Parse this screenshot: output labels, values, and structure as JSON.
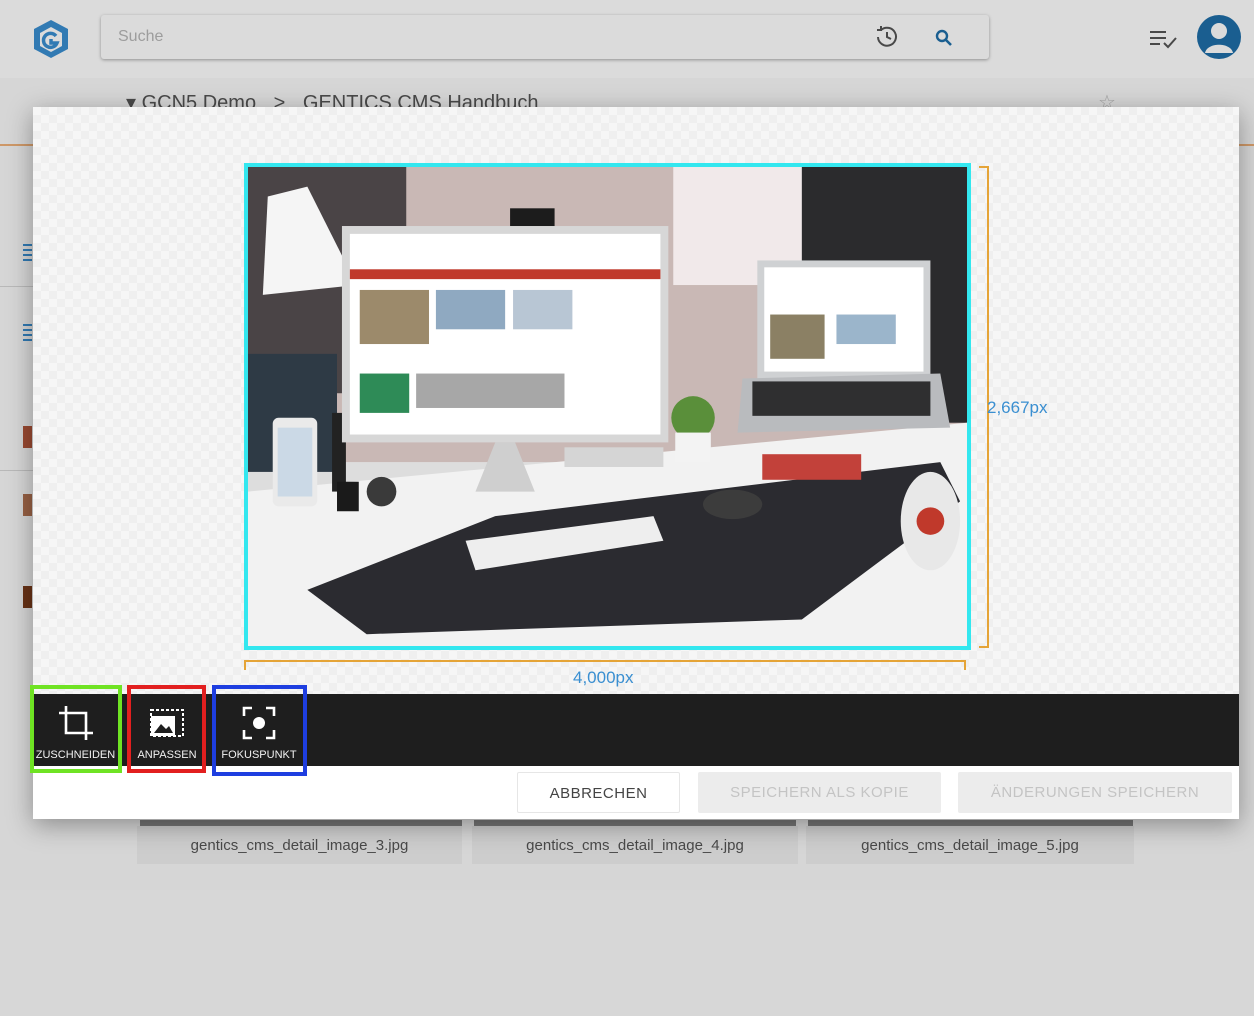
{
  "header": {
    "search_placeholder": "Suche",
    "icons": [
      "history-icon",
      "search-icon",
      "tasks-icon",
      "user-avatar-icon"
    ]
  },
  "breadcrumb": {
    "items": [
      "GCN5 Demo",
      "GENTICS CMS Handbuch"
    ],
    "separator": ">"
  },
  "thumbnails": [
    "gentics_cms_detail_image_3.jpg",
    "gentics_cms_detail_image_4.jpg",
    "gentics_cms_detail_image_5.jpg"
  ],
  "editor": {
    "width_label": "4,000px",
    "height_label": "2,667px",
    "crop_frame_color": "#33e7ef",
    "ruler_color": "#e5a437",
    "tools": [
      {
        "label": "ZUSCHNEIDEN",
        "icon": "crop-icon"
      },
      {
        "label": "ANPASSEN",
        "icon": "resize-image-icon"
      },
      {
        "label": "FOKUSPUNKT",
        "icon": "focal-point-icon"
      }
    ],
    "buttons": {
      "cancel": "ABBRECHEN",
      "save_copy": "SPEICHERN ALS KOPIE",
      "save_changes": "ÄNDERUNGEN SPEICHERN"
    }
  },
  "colors": {
    "brand": "#1f6ea8",
    "accent_orange": "#f0b27a",
    "highlight_crop": "#6fe323",
    "highlight_resize": "#e21f1f",
    "highlight_focal": "#1e3ee0"
  }
}
